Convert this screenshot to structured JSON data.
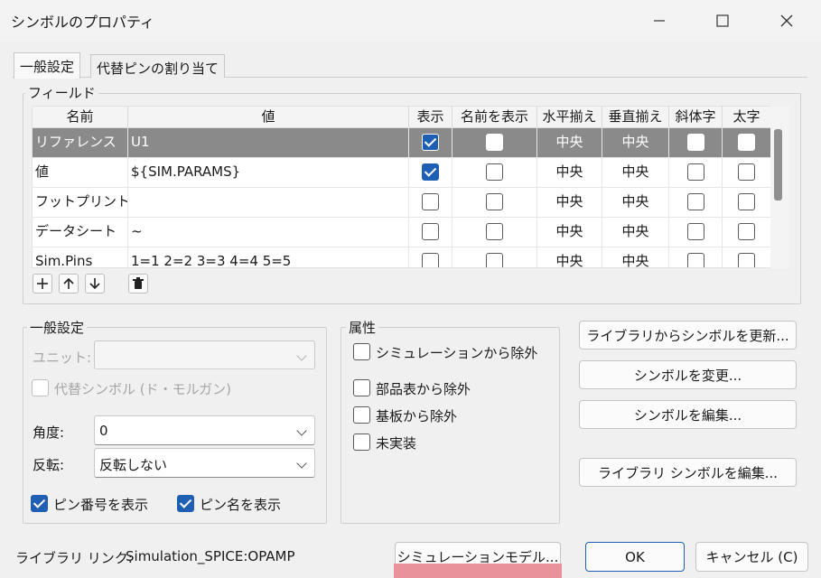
{
  "window": {
    "title": "シンボルのプロパティ"
  },
  "tabs": [
    {
      "label": "一般設定",
      "active": true
    },
    {
      "label": "代替ピンの割り当て",
      "active": false
    }
  ],
  "fields": {
    "group_title": "フィールド",
    "columns": [
      "名前",
      "値",
      "表示",
      "名前を表示",
      "水平揃え",
      "垂直揃え",
      "斜体字",
      "太字"
    ],
    "rows": [
      {
        "name": "リファレンス",
        "value": "U1",
        "show": true,
        "show_name": false,
        "h_align": "中央",
        "v_align": "中央",
        "italic": false,
        "bold": false,
        "selected": true
      },
      {
        "name": "値",
        "value": "${SIM.PARAMS}",
        "show": true,
        "show_name": false,
        "h_align": "中央",
        "v_align": "中央",
        "italic": false,
        "bold": false,
        "selected": false
      },
      {
        "name": "フットプリント",
        "value": "",
        "show": false,
        "show_name": false,
        "h_align": "中央",
        "v_align": "中央",
        "italic": false,
        "bold": false,
        "selected": false
      },
      {
        "name": "データシート",
        "value": "~",
        "show": false,
        "show_name": false,
        "h_align": "中央",
        "v_align": "中央",
        "italic": false,
        "bold": false,
        "selected": false
      },
      {
        "name": "Sim.Pins",
        "value": "1=1 2=2 3=3 4=4 5=5",
        "show": false,
        "show_name": false,
        "h_align": "中央",
        "v_align": "中央",
        "italic": false,
        "bold": false,
        "selected": false
      }
    ],
    "toolbar_icons": [
      "add-icon",
      "move-up-icon",
      "move-down-icon",
      "delete-icon"
    ]
  },
  "general": {
    "group_title": "一般設定",
    "unit_label": "ユニット:",
    "unit_value": "",
    "alt_symbol_label": "代替シンボル (ド・モルガン)",
    "alt_symbol_checked": false,
    "angle_label": "角度:",
    "angle_value": "0",
    "mirror_label": "反転:",
    "mirror_value": "反転しない",
    "show_pin_numbers_label": "ピン番号を表示",
    "show_pin_numbers": true,
    "show_pin_names_label": "ピン名を表示",
    "show_pin_names": true
  },
  "attributes": {
    "group_title": "属性",
    "exclude_sim_label": "シミュレーションから除外",
    "exclude_sim": false,
    "exclude_bom_label": "部品表から除外",
    "exclude_bom": false,
    "exclude_board_label": "基板から除外",
    "exclude_board": false,
    "dnp_label": "未実装",
    "dnp": false
  },
  "actions": {
    "update_from_library": "ライブラリからシンボルを更新...",
    "change_symbol": "シンボルを変更...",
    "edit_symbol": "シンボルを編集...",
    "edit_library_symbol": "ライブラリ シンボルを編集..."
  },
  "footer": {
    "library_link_label": "ライブラリ リンク:",
    "library_link_value": "Simulation_SPICE:OPAMP",
    "sim_model_button": "シミュレーションモデル...",
    "ok_button": "OK",
    "cancel_button": "キャンセル (C)"
  },
  "colors": {
    "selected_row": "#8a8a8a",
    "checkbox_checked": "#1f5fb3",
    "highlight_bar": "#e9929b"
  }
}
